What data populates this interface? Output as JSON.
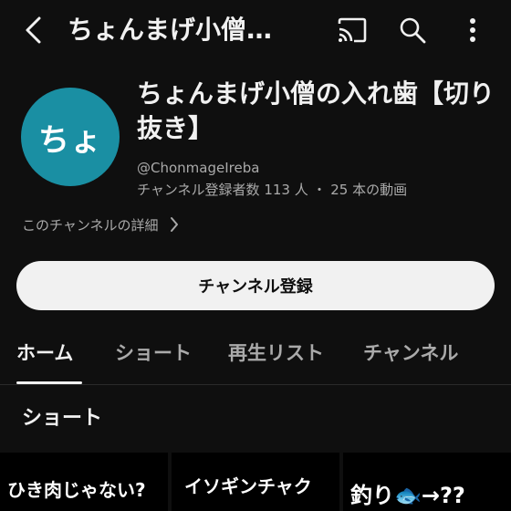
{
  "topbar": {
    "title": "ちょんまげ小僧…",
    "icons": {
      "back": "back-icon",
      "cast": "cast-icon",
      "search": "search-icon",
      "more": "more-vert-icon"
    }
  },
  "channel": {
    "avatar_text": "ちょ",
    "avatar_color": "#1a8fa3",
    "name": "ちょんまげ小僧の入れ歯【切り抜き】",
    "handle": "@ChonmageIreba",
    "stats": "チャンネル登録者数 113 人 ・ 25 本の動画",
    "details_link": "このチャンネルの詳細"
  },
  "subscribe_label": "チャンネル登録",
  "tabs": [
    {
      "label": "ホーム",
      "active": true
    },
    {
      "label": "ショート",
      "active": false
    },
    {
      "label": "再生リスト",
      "active": false
    },
    {
      "label": "チャンネル",
      "active": false
    }
  ],
  "section": {
    "title": "ショート"
  },
  "shorts": [
    {
      "line1": "ひき肉じゃない?",
      "line2": ""
    },
    {
      "line1": "イソギンチャク",
      "line2": ""
    },
    {
      "line1": "釣り",
      "fish": "🐟",
      "line1_tail": "→??"
    }
  ]
}
